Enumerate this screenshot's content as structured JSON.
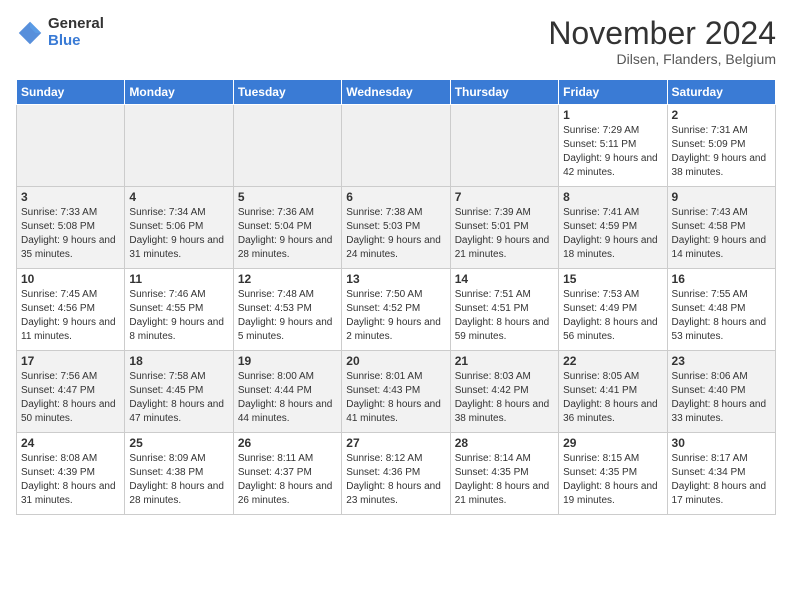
{
  "header": {
    "logo_general": "General",
    "logo_blue": "Blue",
    "month_title": "November 2024",
    "location": "Dilsen, Flanders, Belgium"
  },
  "weekdays": [
    "Sunday",
    "Monday",
    "Tuesday",
    "Wednesday",
    "Thursday",
    "Friday",
    "Saturday"
  ],
  "weeks": [
    [
      {
        "day": "",
        "info": ""
      },
      {
        "day": "",
        "info": ""
      },
      {
        "day": "",
        "info": ""
      },
      {
        "day": "",
        "info": ""
      },
      {
        "day": "",
        "info": ""
      },
      {
        "day": "1",
        "info": "Sunrise: 7:29 AM\nSunset: 5:11 PM\nDaylight: 9 hours and 42 minutes."
      },
      {
        "day": "2",
        "info": "Sunrise: 7:31 AM\nSunset: 5:09 PM\nDaylight: 9 hours and 38 minutes."
      }
    ],
    [
      {
        "day": "3",
        "info": "Sunrise: 7:33 AM\nSunset: 5:08 PM\nDaylight: 9 hours and 35 minutes."
      },
      {
        "day": "4",
        "info": "Sunrise: 7:34 AM\nSunset: 5:06 PM\nDaylight: 9 hours and 31 minutes."
      },
      {
        "day": "5",
        "info": "Sunrise: 7:36 AM\nSunset: 5:04 PM\nDaylight: 9 hours and 28 minutes."
      },
      {
        "day": "6",
        "info": "Sunrise: 7:38 AM\nSunset: 5:03 PM\nDaylight: 9 hours and 24 minutes."
      },
      {
        "day": "7",
        "info": "Sunrise: 7:39 AM\nSunset: 5:01 PM\nDaylight: 9 hours and 21 minutes."
      },
      {
        "day": "8",
        "info": "Sunrise: 7:41 AM\nSunset: 4:59 PM\nDaylight: 9 hours and 18 minutes."
      },
      {
        "day": "9",
        "info": "Sunrise: 7:43 AM\nSunset: 4:58 PM\nDaylight: 9 hours and 14 minutes."
      }
    ],
    [
      {
        "day": "10",
        "info": "Sunrise: 7:45 AM\nSunset: 4:56 PM\nDaylight: 9 hours and 11 minutes."
      },
      {
        "day": "11",
        "info": "Sunrise: 7:46 AM\nSunset: 4:55 PM\nDaylight: 9 hours and 8 minutes."
      },
      {
        "day": "12",
        "info": "Sunrise: 7:48 AM\nSunset: 4:53 PM\nDaylight: 9 hours and 5 minutes."
      },
      {
        "day": "13",
        "info": "Sunrise: 7:50 AM\nSunset: 4:52 PM\nDaylight: 9 hours and 2 minutes."
      },
      {
        "day": "14",
        "info": "Sunrise: 7:51 AM\nSunset: 4:51 PM\nDaylight: 8 hours and 59 minutes."
      },
      {
        "day": "15",
        "info": "Sunrise: 7:53 AM\nSunset: 4:49 PM\nDaylight: 8 hours and 56 minutes."
      },
      {
        "day": "16",
        "info": "Sunrise: 7:55 AM\nSunset: 4:48 PM\nDaylight: 8 hours and 53 minutes."
      }
    ],
    [
      {
        "day": "17",
        "info": "Sunrise: 7:56 AM\nSunset: 4:47 PM\nDaylight: 8 hours and 50 minutes."
      },
      {
        "day": "18",
        "info": "Sunrise: 7:58 AM\nSunset: 4:45 PM\nDaylight: 8 hours and 47 minutes."
      },
      {
        "day": "19",
        "info": "Sunrise: 8:00 AM\nSunset: 4:44 PM\nDaylight: 8 hours and 44 minutes."
      },
      {
        "day": "20",
        "info": "Sunrise: 8:01 AM\nSunset: 4:43 PM\nDaylight: 8 hours and 41 minutes."
      },
      {
        "day": "21",
        "info": "Sunrise: 8:03 AM\nSunset: 4:42 PM\nDaylight: 8 hours and 38 minutes."
      },
      {
        "day": "22",
        "info": "Sunrise: 8:05 AM\nSunset: 4:41 PM\nDaylight: 8 hours and 36 minutes."
      },
      {
        "day": "23",
        "info": "Sunrise: 8:06 AM\nSunset: 4:40 PM\nDaylight: 8 hours and 33 minutes."
      }
    ],
    [
      {
        "day": "24",
        "info": "Sunrise: 8:08 AM\nSunset: 4:39 PM\nDaylight: 8 hours and 31 minutes."
      },
      {
        "day": "25",
        "info": "Sunrise: 8:09 AM\nSunset: 4:38 PM\nDaylight: 8 hours and 28 minutes."
      },
      {
        "day": "26",
        "info": "Sunrise: 8:11 AM\nSunset: 4:37 PM\nDaylight: 8 hours and 26 minutes."
      },
      {
        "day": "27",
        "info": "Sunrise: 8:12 AM\nSunset: 4:36 PM\nDaylight: 8 hours and 23 minutes."
      },
      {
        "day": "28",
        "info": "Sunrise: 8:14 AM\nSunset: 4:35 PM\nDaylight: 8 hours and 21 minutes."
      },
      {
        "day": "29",
        "info": "Sunrise: 8:15 AM\nSunset: 4:35 PM\nDaylight: 8 hours and 19 minutes."
      },
      {
        "day": "30",
        "info": "Sunrise: 8:17 AM\nSunset: 4:34 PM\nDaylight: 8 hours and 17 minutes."
      }
    ]
  ]
}
